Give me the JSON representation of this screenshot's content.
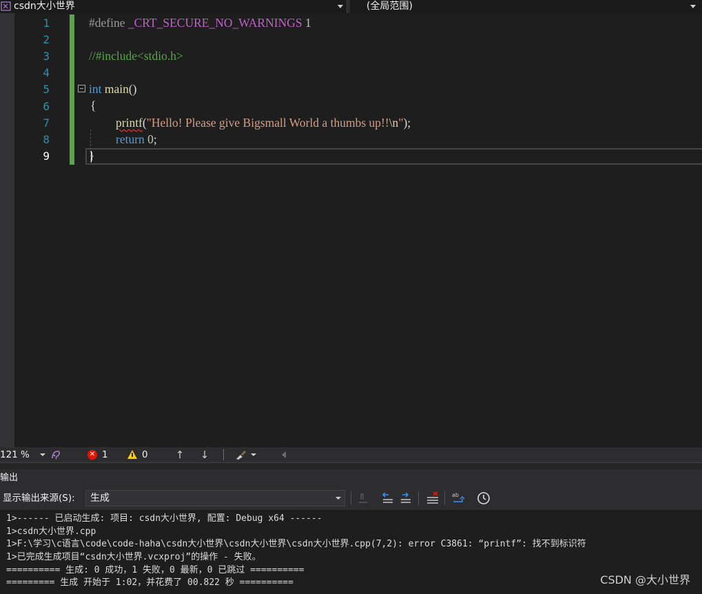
{
  "navbar": {
    "project_name": "csdn大小世界",
    "scope": "(全局范围)"
  },
  "editor": {
    "line_numbers": [
      "1",
      "2",
      "3",
      "4",
      "5",
      "6",
      "7",
      "8",
      "9"
    ],
    "line1": {
      "directive": "#define",
      "macro": "_CRT_SECURE_NO_WARNINGS",
      "value": "1"
    },
    "line3": {
      "comment": "//#include<stdio.h>"
    },
    "line5": {
      "keyword": "int",
      "function": "main",
      "parens": "()"
    },
    "line6": {
      "brace": "{"
    },
    "line7": {
      "function": "printf",
      "open": "(",
      "string_start": "\"Hello! Please give Bigsmall World a thumbs up!!",
      "escape": "\\n",
      "string_end": "\"",
      "close": ");"
    },
    "line8": {
      "keyword": "return",
      "value": "0",
      "semicolon": ";"
    },
    "line9": {
      "brace": "}"
    }
  },
  "status_strip": {
    "zoom": "121 %",
    "error_count": "1",
    "warning_count": "0"
  },
  "output": {
    "title": "输出",
    "source_label": "显示输出来源(S):",
    "source_value": "生成",
    "lines": [
      "1>------ 已启动生成: 项目: csdn大小世界, 配置: Debug x64 ------",
      "1>csdn大小世界.cpp",
      "1>F:\\学习\\c语言\\code\\code-haha\\csdn大小世界\\csdn大小世界\\csdn大小世界.cpp(7,2): error C3861: “printf”: 找不到标识符",
      "1>已完成生成项目“csdn大小世界.vcxproj”的操作 - 失败。",
      "========== 生成: 0 成功，1 失败，0 最新，0 已跳过 ==========",
      "========= 生成 开始于 1:02，并花费了 00.822 秒 =========="
    ]
  },
  "watermark": "CSDN @大小世界",
  "colors": {
    "background": "#1e1e1e",
    "keyword": "#569cd6",
    "string": "#d69d85",
    "comment": "#57a64a",
    "macro": "#bd63c5",
    "line_number": "#2b91af",
    "error": "#e51400",
    "warning": "#ffcc00"
  }
}
